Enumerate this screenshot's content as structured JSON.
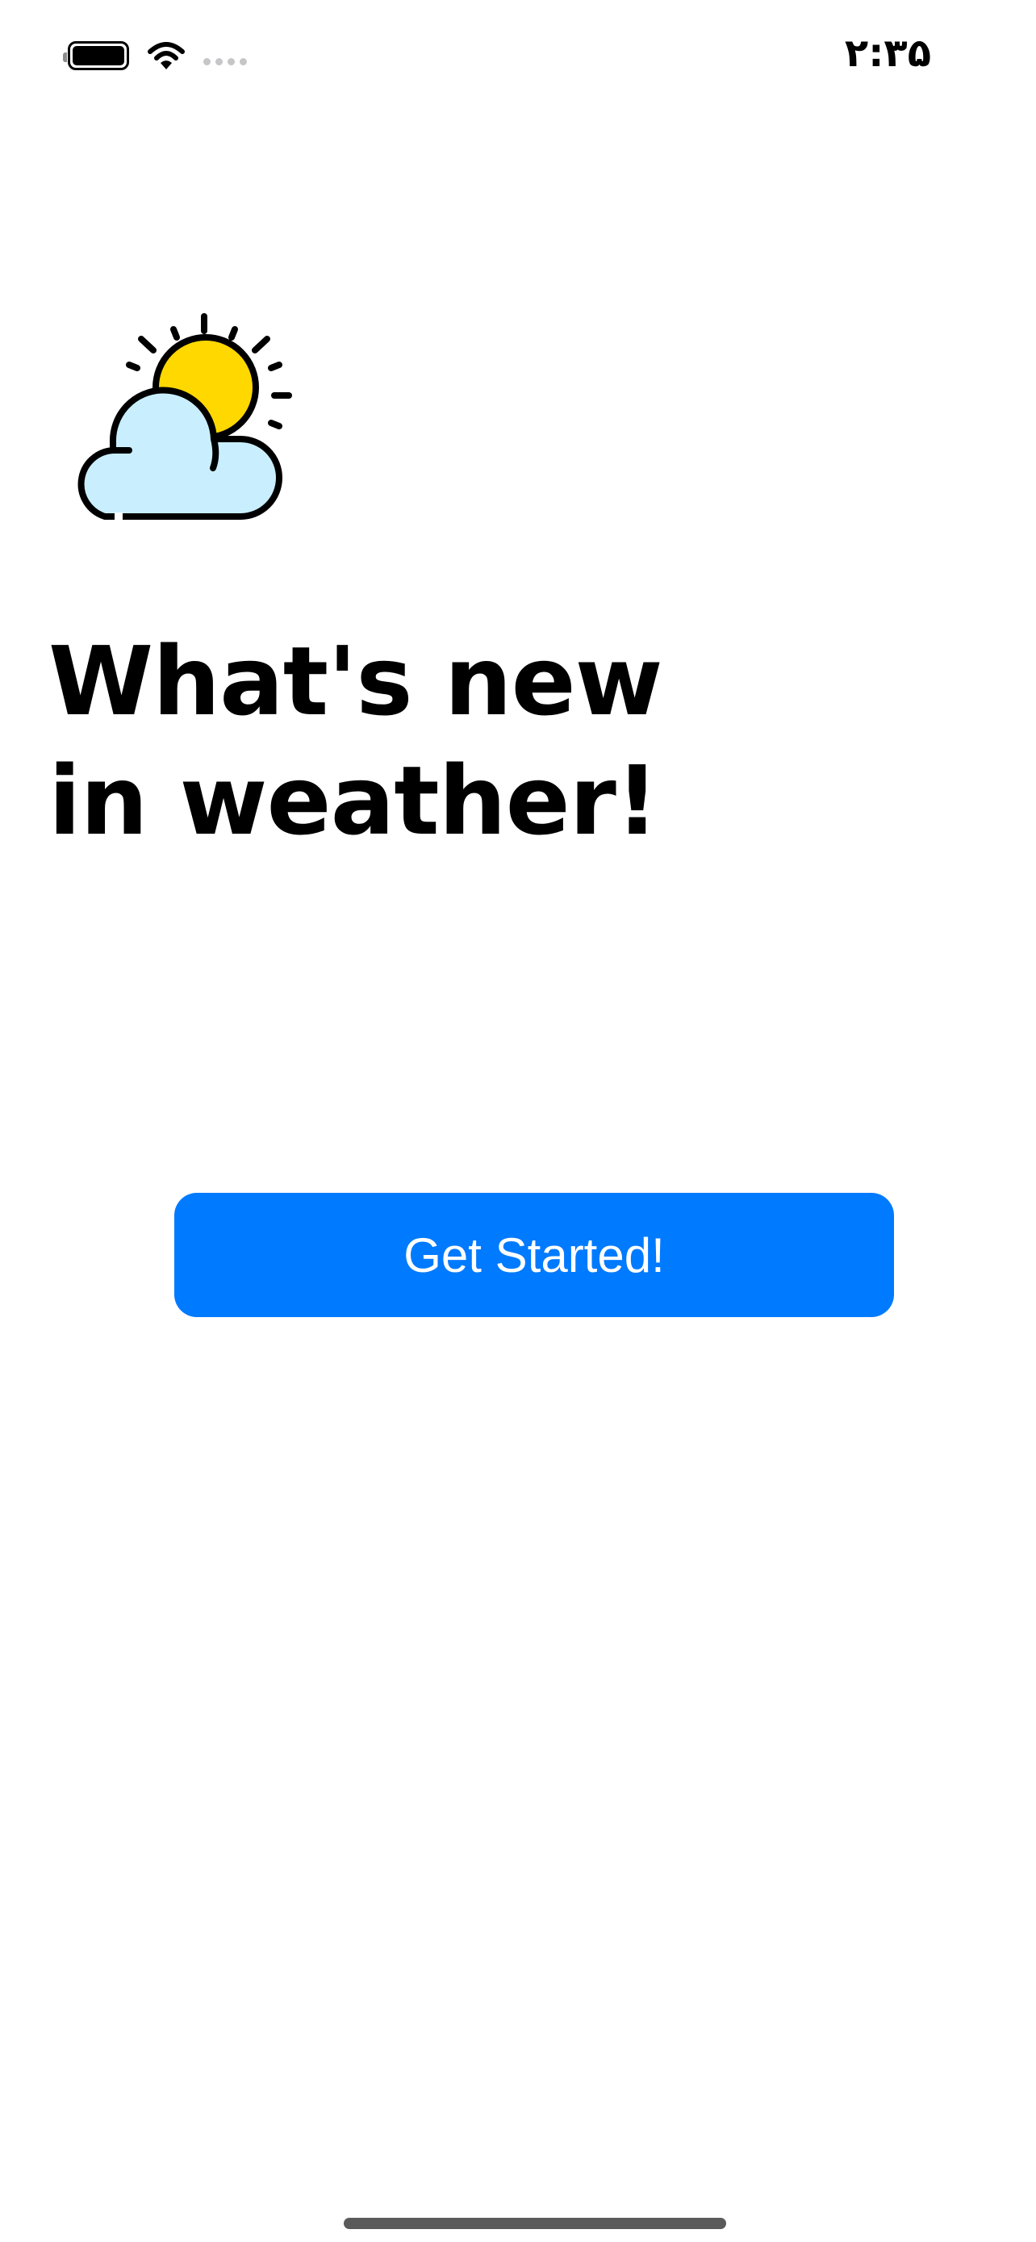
{
  "status_bar": {
    "time": "۲:۳۵",
    "battery_icon": "battery-full-icon",
    "wifi_icon": "wifi-icon",
    "signal_icon": "cellular-no-signal-icon"
  },
  "hero": {
    "illustration": "partly-cloudy-icon",
    "title_line1": "What's new",
    "title_line2": "in weather!"
  },
  "actions": {
    "get_started_label": "Get Started!"
  },
  "colors": {
    "accent": "#007aff",
    "sun": "#ffd800",
    "cloud": "#c9efff",
    "background": "#ffffff",
    "text": "#000000"
  }
}
